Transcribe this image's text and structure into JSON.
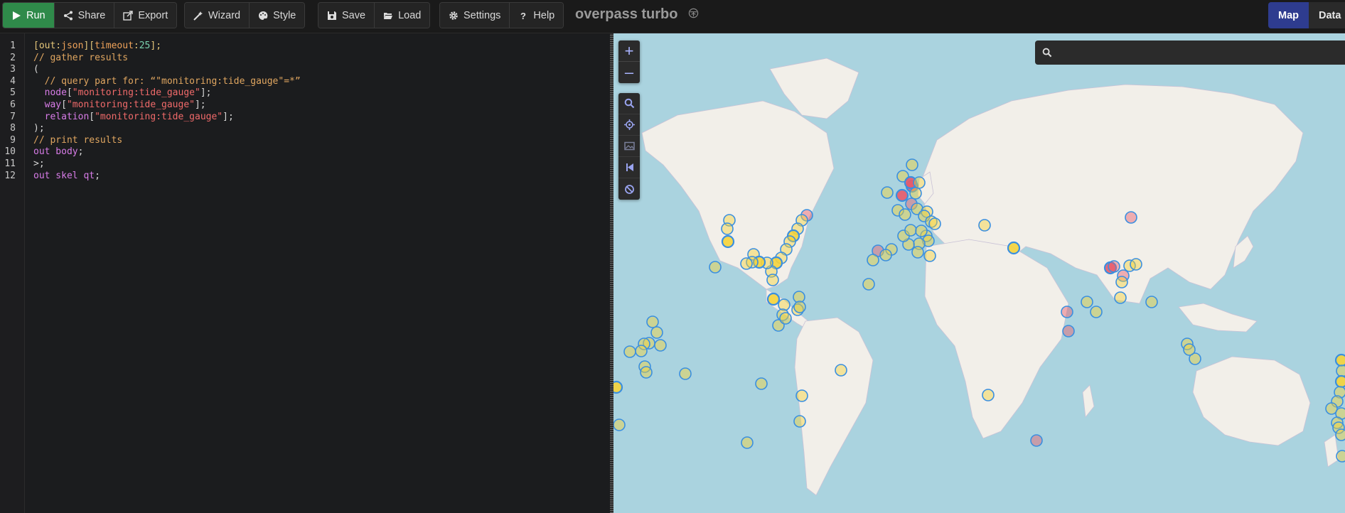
{
  "toolbar": {
    "run": "Run",
    "share": "Share",
    "export": "Export",
    "wizard": "Wizard",
    "style": "Style",
    "save": "Save",
    "load": "Load",
    "settings": "Settings",
    "help": "Help"
  },
  "app_title": "overpass turbo",
  "tabs": {
    "map": "Map",
    "data": "Data"
  },
  "editor": {
    "line_numbers": [
      "1",
      "2",
      "3",
      "4",
      "5",
      "6",
      "7",
      "8",
      "9",
      "10",
      "11",
      "12"
    ],
    "lines": [
      [
        {
          "t": "[out:",
          "c": "c-yellow"
        },
        {
          "t": "json",
          "c": "c-orange"
        },
        {
          "t": "][",
          "c": "c-yellow"
        },
        {
          "t": "timeout",
          "c": "c-orange"
        },
        {
          "t": ":",
          "c": "c-yellow"
        },
        {
          "t": "25",
          "c": "c-num"
        },
        {
          "t": "];",
          "c": "c-yellow"
        }
      ],
      [
        {
          "t": "// gather results",
          "c": "c-comment"
        }
      ],
      [
        {
          "t": "(",
          "c": "c-plain"
        }
      ],
      [
        {
          "t": "  // query part for: “\"monitoring:tide_gauge\"=*”",
          "c": "c-comment"
        }
      ],
      [
        {
          "t": "  node",
          "c": "c-purple"
        },
        {
          "t": "[",
          "c": "c-plain"
        },
        {
          "t": "\"monitoring:tide_gauge\"",
          "c": "c-red"
        },
        {
          "t": "];",
          "c": "c-plain"
        }
      ],
      [
        {
          "t": "  way",
          "c": "c-purple"
        },
        {
          "t": "[",
          "c": "c-plain"
        },
        {
          "t": "\"monitoring:tide_gauge\"",
          "c": "c-red"
        },
        {
          "t": "];",
          "c": "c-plain"
        }
      ],
      [
        {
          "t": "  relation",
          "c": "c-purple"
        },
        {
          "t": "[",
          "c": "c-plain"
        },
        {
          "t": "\"monitoring:tide_gauge\"",
          "c": "c-red"
        },
        {
          "t": "];",
          "c": "c-plain"
        }
      ],
      [
        {
          "t": ");",
          "c": "c-plain"
        }
      ],
      [
        {
          "t": "// print results",
          "c": "c-comment"
        }
      ],
      [
        {
          "t": "out body",
          "c": "c-purple"
        },
        {
          "t": ";",
          "c": "c-plain"
        }
      ],
      [
        {
          "t": ">;",
          "c": "c-plain"
        }
      ],
      [
        {
          "t": "out skel qt",
          "c": "c-purple"
        },
        {
          "t": ";",
          "c": "c-plain"
        }
      ]
    ]
  },
  "map": {
    "search_placeholder": "",
    "zoom_in": "+",
    "zoom_out": "–",
    "tools": [
      "search-icon",
      "locate-icon",
      "image-icon",
      "skip-back-icon",
      "clear-icon"
    ]
  },
  "colors": {
    "run_green": "#2f8a4a",
    "map_tab_active": "#2e3c8f",
    "water": "#aad3df",
    "land": "#f2efe9",
    "marker_yellow": "#f5d33a",
    "marker_red": "#e85a6a",
    "marker_stroke": "#3a8fe0"
  }
}
